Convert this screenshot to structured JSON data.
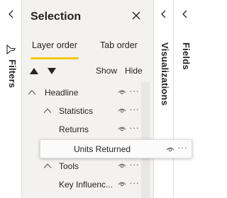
{
  "filters_rail": {
    "label": "Filters",
    "collapse_icon": "chevron-left-icon",
    "filter_icon": "filter-icon"
  },
  "selection_pane": {
    "title": "Selection",
    "close_icon": "close-icon",
    "tabs": [
      {
        "label": "Layer order",
        "selected": true
      },
      {
        "label": "Tab order",
        "selected": false
      }
    ],
    "accent_color": "#f2c811",
    "move_up_icon": "triangle-up-icon",
    "move_down_icon": "triangle-down-icon",
    "show_label": "Show",
    "hide_label": "Hide",
    "tree": [
      {
        "label": "Headline",
        "level": 0,
        "expanded": true,
        "visible": true
      },
      {
        "label": "Statistics",
        "level": 1,
        "expanded": true,
        "visible": true
      },
      {
        "label": "Returns",
        "level": 2,
        "visible": true
      },
      {
        "label": "Tools",
        "level": 1,
        "expanded": true,
        "visible": true
      },
      {
        "label": "Key Influenc...",
        "level": 2,
        "visible": true
      }
    ],
    "dragging_item": {
      "label": "Units Returned",
      "visible": true
    },
    "more_label": "···"
  },
  "visualizations_rail": {
    "label": "Visualizations",
    "collapse_icon": "chevron-left-icon"
  },
  "fields_rail": {
    "label": "Fields",
    "collapse_icon": "chevron-left-icon"
  }
}
